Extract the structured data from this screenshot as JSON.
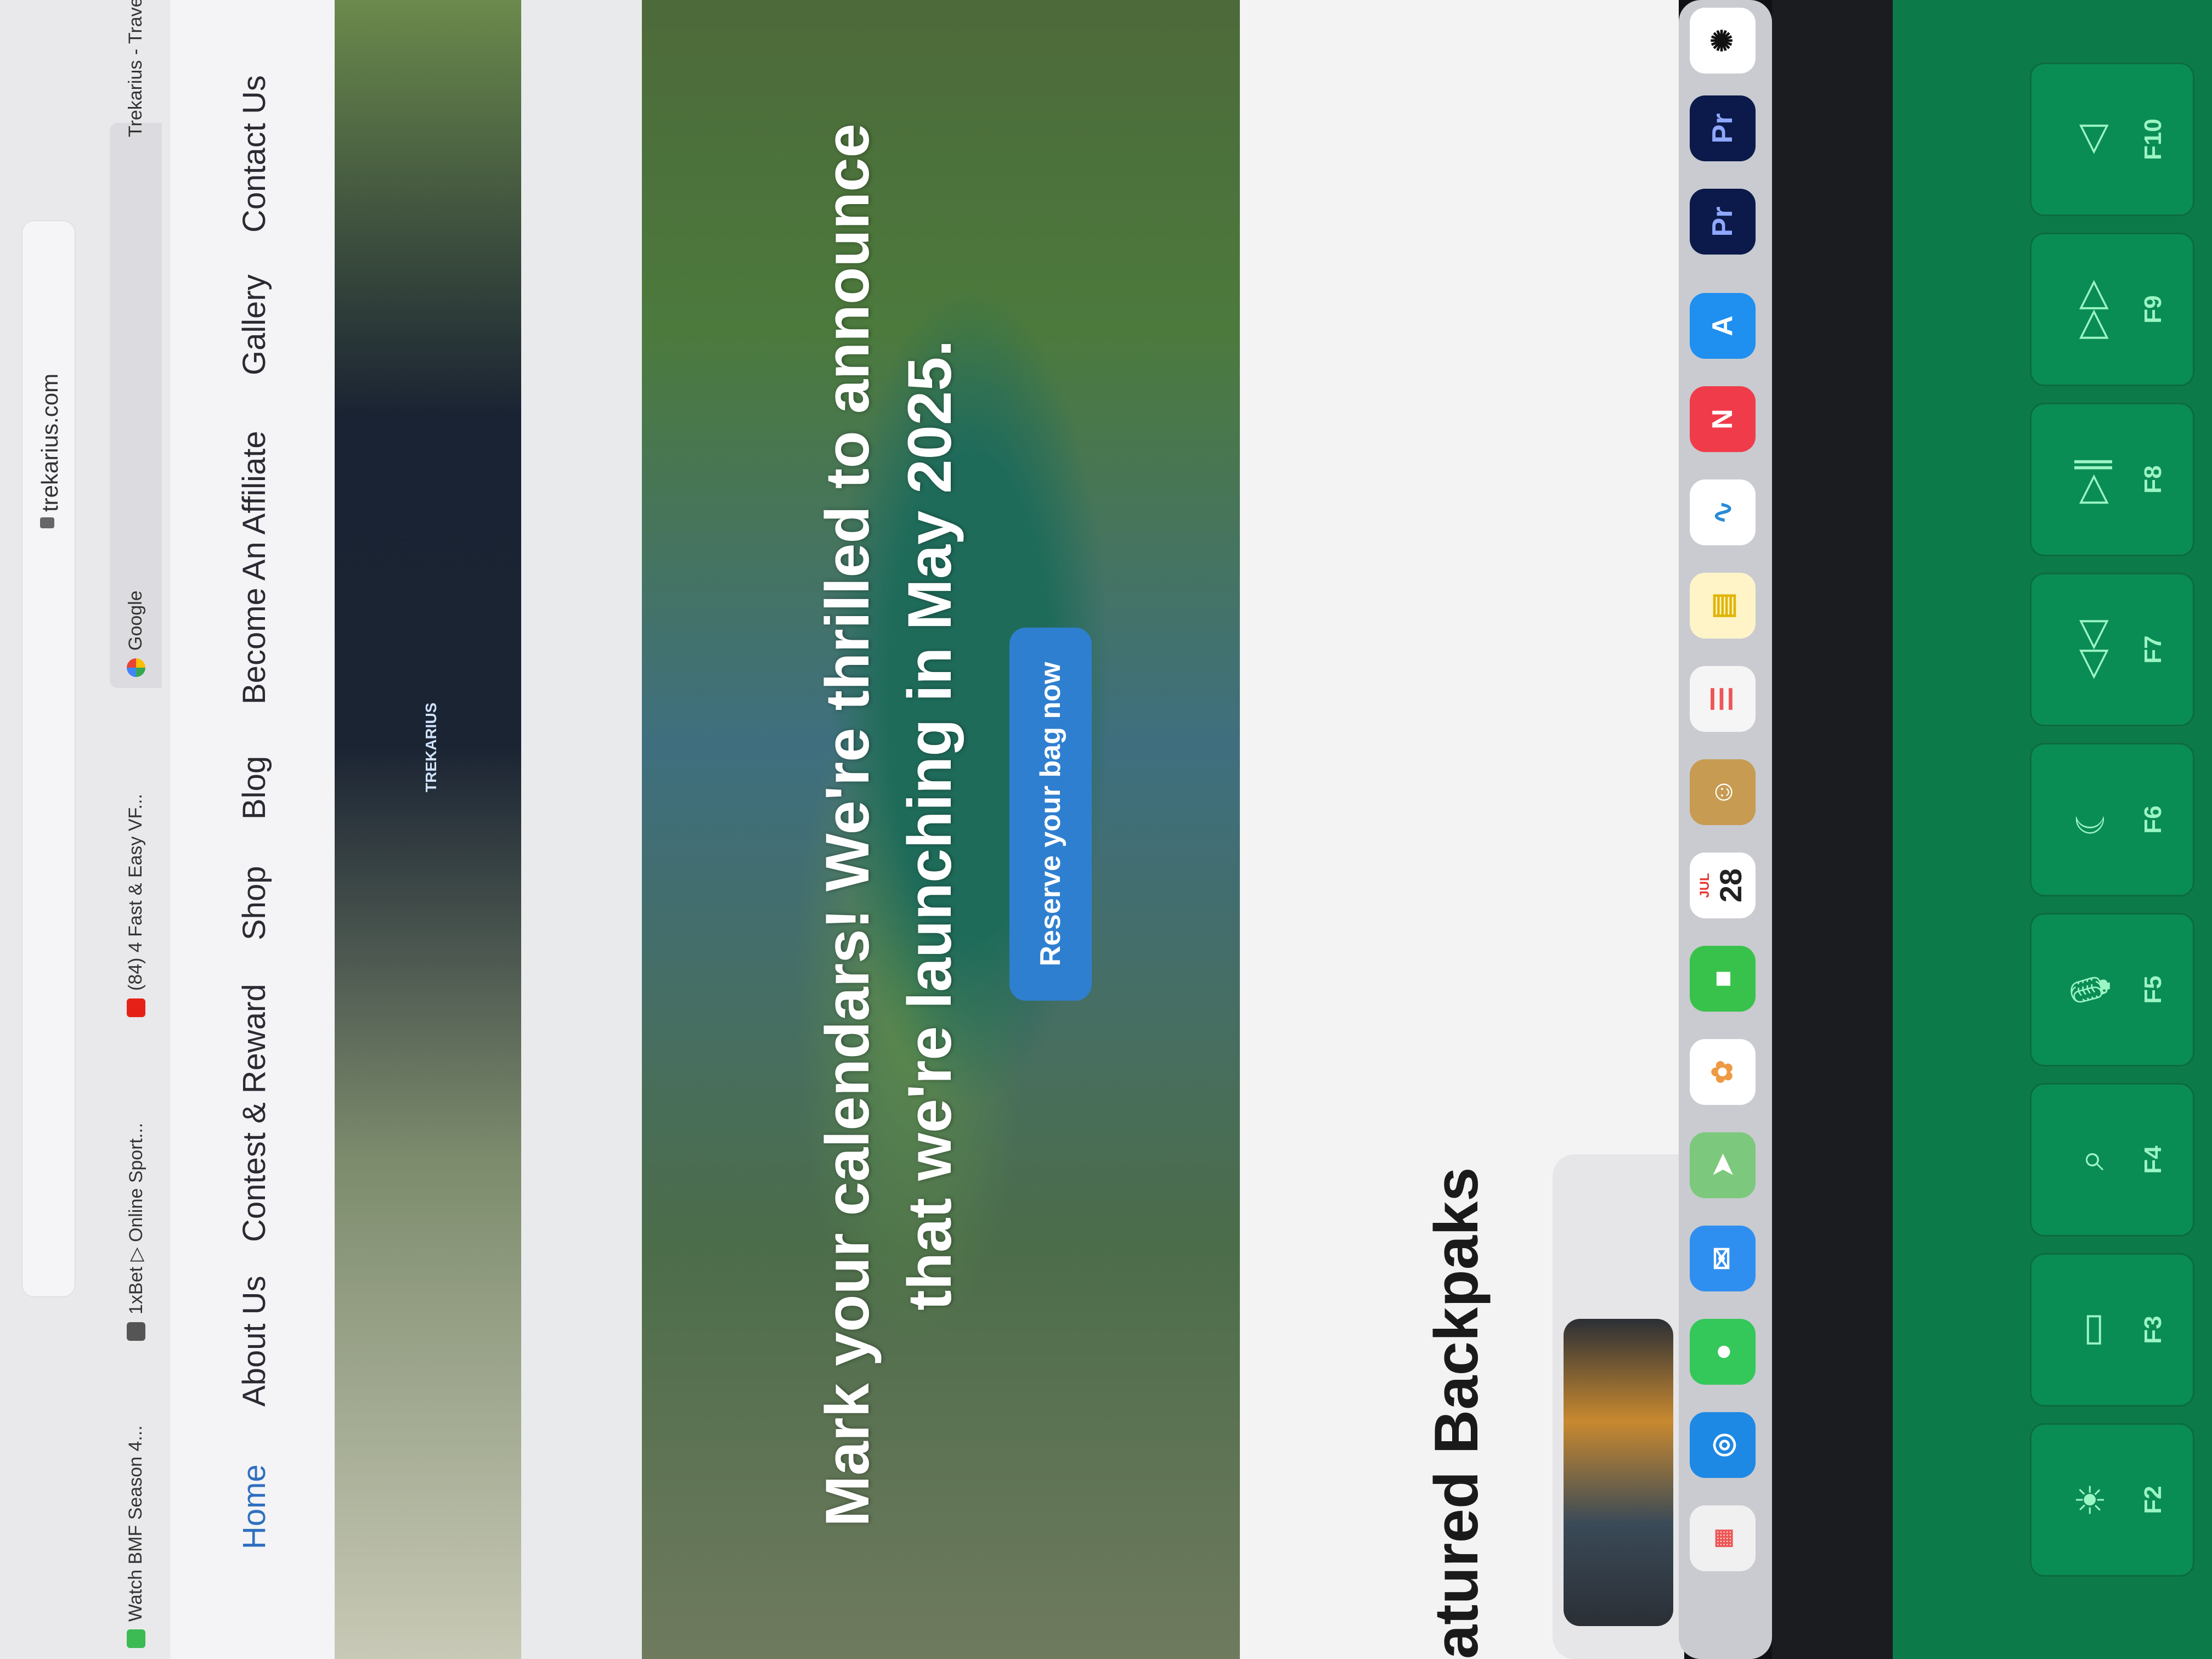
{
  "browser": {
    "url": "trekarius.com",
    "tabs": [
      {
        "label": "Watch BMF Season 4...",
        "icon": "play-icon"
      },
      {
        "label": "1xBet ▷ Online Sport...",
        "icon": "1xbet-icon"
      },
      {
        "label": "(84) 4 Fast & Easy VF...",
        "icon": "youtube-icon"
      },
      {
        "label": "Google",
        "icon": "google-icon"
      },
      {
        "label": "Trekarius - Travel G",
        "icon": "trekarius-icon"
      }
    ]
  },
  "nav": {
    "items": [
      "Home",
      "About Us",
      "Contest & Reward",
      "Shop",
      "Blog",
      "Become An Affiliate",
      "Gallery",
      "Contact Us"
    ]
  },
  "hero": {
    "title": "Mark your calendars! We're thrilled to announce that we're launching in May 2025.",
    "cta": "Reserve your bag now",
    "pack_brand": "TREKARIUS"
  },
  "section": {
    "title": "atured Backpaks"
  },
  "dock": {
    "calendar_month": "JUL",
    "calendar_day": "28",
    "apps": [
      "launchpad-icon",
      "safari-icon",
      "messages-icon",
      "mail-icon",
      "maps-icon",
      "photos-icon",
      "facetime-icon",
      "calendar-icon",
      "contacts-icon",
      "reminders-icon",
      "notes-icon",
      "freeform-icon",
      "news-icon",
      "app-store-icon",
      "premiere-pro-icon",
      "premiere-pro-icon",
      "chatgpt-icon"
    ],
    "premiere_label": "Pr"
  },
  "keyboard": {
    "fkeys": [
      {
        "label": "F2",
        "icon": "brightness-icon",
        "sym": "☀"
      },
      {
        "label": "F3",
        "icon": "mission-control-icon",
        "sym": "▭"
      },
      {
        "label": "F4",
        "icon": "search-icon",
        "sym": "⌕"
      },
      {
        "label": "F5",
        "icon": "microphone-icon",
        "sym": "🎙"
      },
      {
        "label": "F6",
        "icon": "moon-icon",
        "sym": "☾"
      },
      {
        "label": "F7",
        "icon": "rewind-icon",
        "sym": "◁◁"
      },
      {
        "label": "F8",
        "icon": "play-pause-icon",
        "sym": "▷∥"
      },
      {
        "label": "F9",
        "icon": "fast-forward-icon",
        "sym": "▷▷"
      },
      {
        "label": "F10",
        "icon": "mute-icon",
        "sym": "◁"
      }
    ]
  }
}
